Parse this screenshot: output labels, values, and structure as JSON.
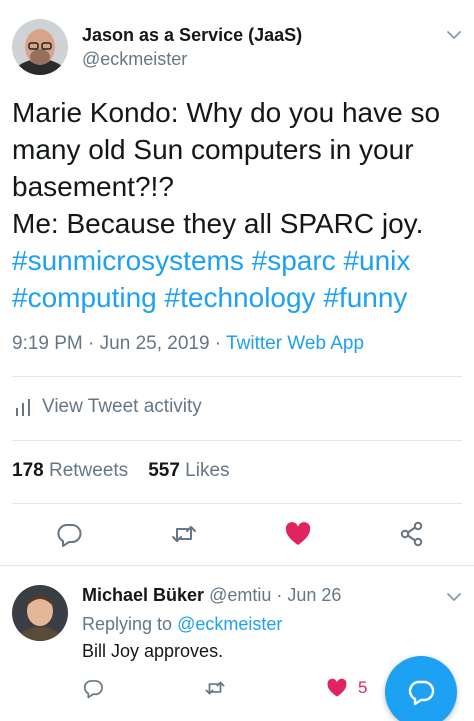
{
  "tweet": {
    "author_name": "Jason as a Service (JaaS)",
    "author_handle": "@eckmeister",
    "text_lines": [
      "Marie Kondo: Why do you have so",
      "many old Sun computers in your",
      "basement?!?",
      "Me: Because they all SPARC joy."
    ],
    "hashtags": [
      "#sunmicrosystems",
      "#sparc",
      "#unix",
      "#computing",
      "#technology",
      "#funny"
    ],
    "time": "9:19 PM",
    "date": "Jun 25, 2019",
    "separator": "·",
    "source": "Twitter Web App",
    "activity_label": "View Tweet activity",
    "retweets_count": "178",
    "retweets_label": "Retweets",
    "likes_count": "557",
    "likes_label": "Likes"
  },
  "reply": {
    "author_name": "Michael Büker",
    "author_handle": "@emtiu",
    "separator": "·",
    "date": "Jun 26",
    "replying_prefix": "Replying to",
    "replying_to": "@eckmeister",
    "text": "Bill Joy approves.",
    "likes_count": "5"
  },
  "colors": {
    "accent": "#1da1f2",
    "like": "#e0245e",
    "secondary_text": "#657786",
    "divider": "#e1e8ed"
  },
  "icons": [
    "caret-down-icon",
    "activity-bars-icon",
    "reply-icon",
    "retweet-icon",
    "heart-icon",
    "share-icon",
    "compose-icon"
  ]
}
